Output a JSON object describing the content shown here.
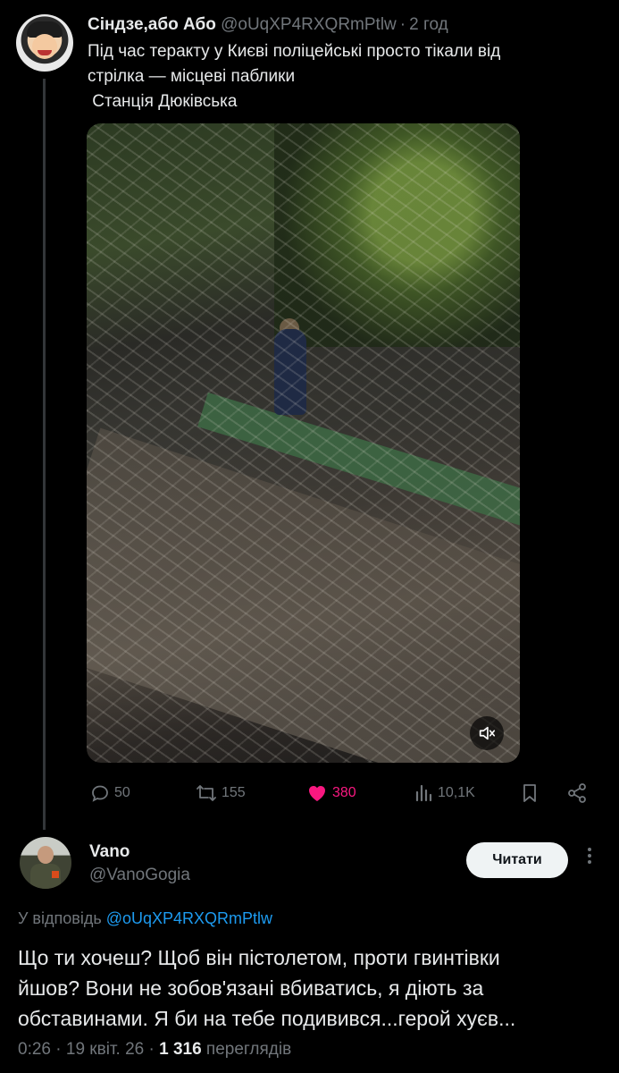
{
  "parent_tweet": {
    "author_name": "Сіндзе,або Або",
    "handle": "@oUqXP4RXQRmPtlw",
    "separator": "·",
    "time": "2 год",
    "text_lines": [
      "Під час теракту у Києві поліцейські просто тікали від",
      "стрілка — місцеві паблики",
      " Станція Дюківська"
    ],
    "stats": {
      "replies": "50",
      "reposts": "155",
      "likes": "380",
      "views": "10,1K"
    },
    "like_color": "#f91880"
  },
  "reply_tweet": {
    "author_name": "Vano",
    "handle": "@VanoGogia",
    "follow_label": "Читати",
    "replying_prefix": "У відповідь",
    "replying_to": "@oUqXP4RXQRmPtlw",
    "text_lines": [
      "Що ти хочеш? Щоб він пістолетом, проти гвинтівки",
      "йшов? Вони не зобов'язані вбиватись, я діють за",
      "обставинами. Я би на тебе подивився...герой хуєв..."
    ],
    "time": "0:26",
    "date": "19 квіт. 26",
    "views_count": "1 316",
    "views_label": "переглядів",
    "separator": "·"
  },
  "icons": {
    "reply": "comment-bubble-icon",
    "repost": "repost-arrows-icon",
    "like": "heart-icon",
    "views": "bar-chart-icon",
    "bookmark": "bookmark-icon",
    "share": "share-icon",
    "mute": "volume-muted-icon",
    "more": "more-vertical-icon"
  },
  "colors": {
    "background": "#000000",
    "text": "#e7e9ea",
    "muted": "#71767b",
    "link": "#1d9bf0"
  }
}
